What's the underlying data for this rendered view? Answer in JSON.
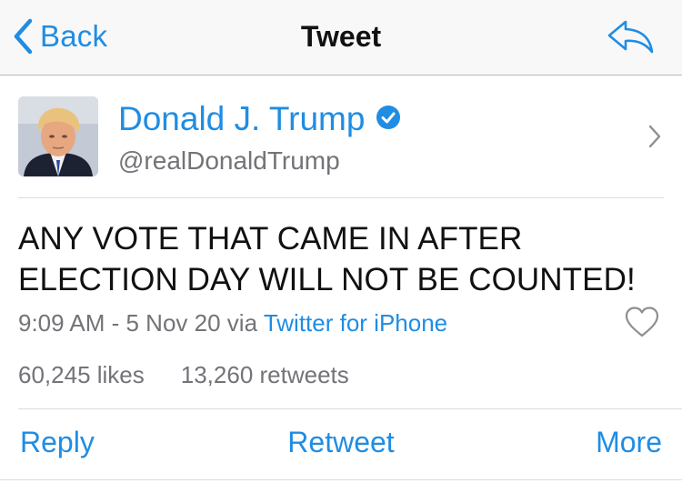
{
  "nav": {
    "back_label": "Back",
    "title": "Tweet",
    "reply_icon": "reply-arrow-icon"
  },
  "author": {
    "display_name": "Donald J. Trump",
    "handle": "@realDonaldTrump",
    "verified": true
  },
  "tweet": {
    "text": "ANY VOTE THAT CAME IN AFTER ELECTION DAY WILL NOT BE COUNTED!",
    "time": "9:09 AM - 5 Nov 20",
    "via_prefix": "via",
    "source": "Twitter for iPhone"
  },
  "stats": {
    "likes": "60,245 likes",
    "retweets": "13,260 retweets"
  },
  "actions": {
    "reply": "Reply",
    "retweet": "Retweet",
    "more": "More"
  },
  "colors": {
    "accent": "#1f8de3",
    "secondary_text": "#737378",
    "nav_background": "#f8f8f8"
  }
}
